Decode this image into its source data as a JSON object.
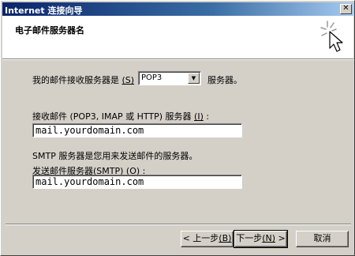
{
  "window": {
    "title": "Internet 连接向导",
    "close_glyph": "✕"
  },
  "header": {
    "heading": "电子邮件服务器名",
    "icon": "wizard-cursor-icon"
  },
  "incoming_type": {
    "label_pre": "我的邮件接收服务器是",
    "label_access": "(S)",
    "selected": "POP3",
    "suffix": "服务器。"
  },
  "incoming_server": {
    "label_pre": "接收邮件 (POP3, IMAP 或 HTTP) 服务器",
    "label_access": "(I)",
    "label_post": ":",
    "value": "mail.yourdomain.com"
  },
  "smtp_note": "SMTP 服务器是您用来发送邮件的服务器。",
  "outgoing_server": {
    "label_pre": "发送邮件服务器(SMTP)",
    "label_access": "(O)",
    "label_post": ":",
    "value": "mail.yourdomain.com"
  },
  "buttons": {
    "back_text": "< 上一步",
    "back_access": "(B)",
    "next_text": "下一步",
    "next_access": "(N)",
    "next_suffix": " >",
    "cancel": "取消"
  }
}
